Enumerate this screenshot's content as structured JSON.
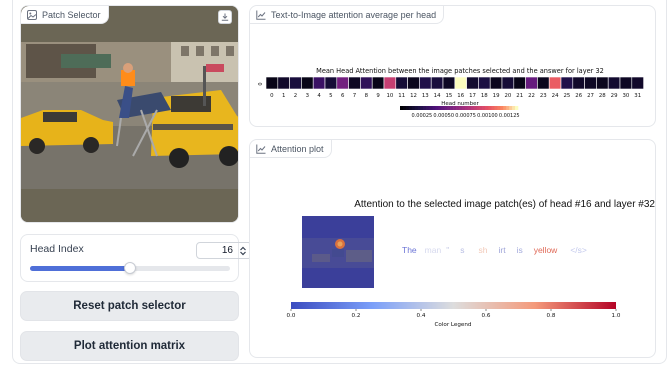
{
  "patch_selector": {
    "label": "Patch Selector",
    "download_icon": "download-icon"
  },
  "head_index": {
    "label": "Head Index",
    "value": "16",
    "min": 0,
    "max": 31,
    "fill_fraction": 0.5
  },
  "buttons": {
    "reset": "Reset patch selector",
    "plot": "Plot attention matrix"
  },
  "heatmap_panel": {
    "label": "Text-to-Image attention average per head",
    "title": "Mean Head Attention between the image patches selected and the answer for layer 32",
    "xlabel": "Head number",
    "ytick": "0",
    "colorbar_ticks": [
      "0.00025",
      "0.00050",
      "0.00075",
      "0.00100",
      "0.00125"
    ]
  },
  "attention_panel": {
    "label": "Attention plot",
    "title": "Attention to the selected image patch(es) of head #16 and layer #32",
    "colorbar_ticks": [
      "0.0",
      "0.2",
      "0.4",
      "0.6",
      "0.8",
      "1.0"
    ],
    "colorbar_label": "Color Legend",
    "tokens": [
      {
        "text": "The",
        "color": "#6b74d6"
      },
      {
        "text": "man",
        "color": "#d6d9ee"
      },
      {
        "text": "\"",
        "color": "#c9cde8"
      },
      {
        "text": "s",
        "color": "#b7bde3"
      },
      {
        "text": "sh",
        "color": "#f2c9b8"
      },
      {
        "text": "irt",
        "color": "#9ea4d8"
      },
      {
        "text": "is",
        "color": "#a4abdc"
      },
      {
        "text": "yellow",
        "color": "#e06a58"
      },
      {
        "text": "</s>",
        "color": "#c2c8ec"
      }
    ]
  },
  "chart_data": [
    {
      "type": "heatmap",
      "title": "Mean Head Attention between the image patches selected and the answer for layer 32",
      "xlabel": "Head number",
      "ylabel": "",
      "x": [
        0,
        1,
        2,
        3,
        4,
        5,
        6,
        7,
        8,
        9,
        10,
        11,
        12,
        13,
        14,
        15,
        16,
        17,
        18,
        19,
        20,
        21,
        22,
        23,
        24,
        25,
        26,
        27,
        28,
        29,
        30,
        31
      ],
      "y": [
        "0"
      ],
      "values": [
        [
          6e-05,
          0.00012,
          0.00018,
          6e-05,
          0.00032,
          0.00016,
          0.00055,
          0.0001,
          0.00028,
          6e-05,
          0.00088,
          0.00016,
          8e-05,
          0.00022,
          0.00018,
          0.0001,
          0.00135,
          0.00014,
          0.0002,
          8e-05,
          0.00016,
          6e-05,
          0.0005,
          8e-05,
          0.00105,
          0.00022,
          0.00012,
          0.0001,
          8e-05,
          0.00014,
          0.0001,
          0.00012
        ]
      ],
      "colorbar_range": [
        0.0,
        0.00135
      ],
      "colorbar_ticks": [
        0.00025,
        0.0005,
        0.00075,
        0.001,
        0.00125
      ]
    },
    {
      "type": "bar",
      "title": "Attention to the selected image patch(es) of head #16 and layer #32",
      "categories": [
        "The",
        "man",
        "\"",
        "s",
        "sh",
        "irt",
        "is",
        "yellow",
        "</s>"
      ],
      "values": [
        0.05,
        0.45,
        0.4,
        0.35,
        0.62,
        0.28,
        0.3,
        0.92,
        0.38
      ],
      "ylim": [
        0,
        1
      ],
      "colorbar_label": "Color Legend"
    }
  ]
}
